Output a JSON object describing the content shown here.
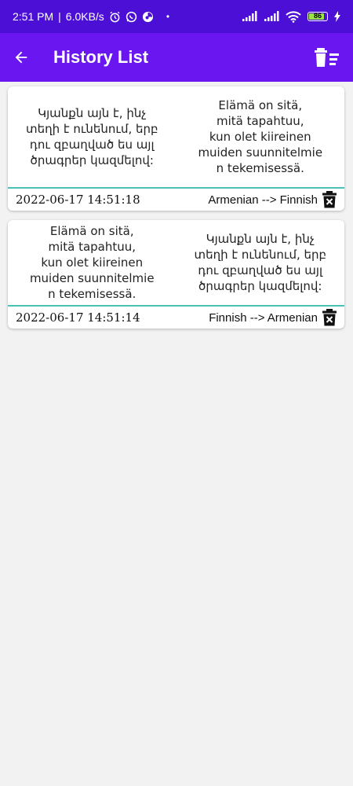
{
  "status_bar": {
    "time": "2:51 PM",
    "speed": "6.0KB/s",
    "battery": "86",
    "dot": "•"
  },
  "app_bar": {
    "title": "History List"
  },
  "history": [
    {
      "source_text": "Կյանքն այն է, ինչ\nտեղի է ունենում, երբ\nդու զբաղված ես այլ\nծրագրեր կազմելով:",
      "translated_text": "Elämä on sitä,\nmitä tapahtuu,\nkun olet kiireinen\nmuiden suunnitelmie\nn tekemisessä.",
      "timestamp": "2022-06-17 14:51:18",
      "direction": "Armenian --> Finnish"
    },
    {
      "source_text": "Elämä on sitä,\nmitä tapahtuu,\nkun olet kiireinen\nmuiden suunnitelmie\nn tekemisessä.",
      "translated_text": "Կյանքն այն է, ինչ\nտեղի է ունենում, երբ\nդու զբաղված ես այլ\nծրագրեր կազմելով:",
      "timestamp": "2022-06-17 14:51:14",
      "direction": "Finnish --> Armenian"
    }
  ],
  "colors": {
    "status_bar": "#4b0fd6",
    "app_bar": "#6a16f0",
    "divider": "#4dc0b5",
    "battery": "#9be34a"
  },
  "icons": {
    "back": "arrow-left-icon",
    "clear_all": "delete-sweep-icon",
    "delete": "delete-forever-icon"
  }
}
